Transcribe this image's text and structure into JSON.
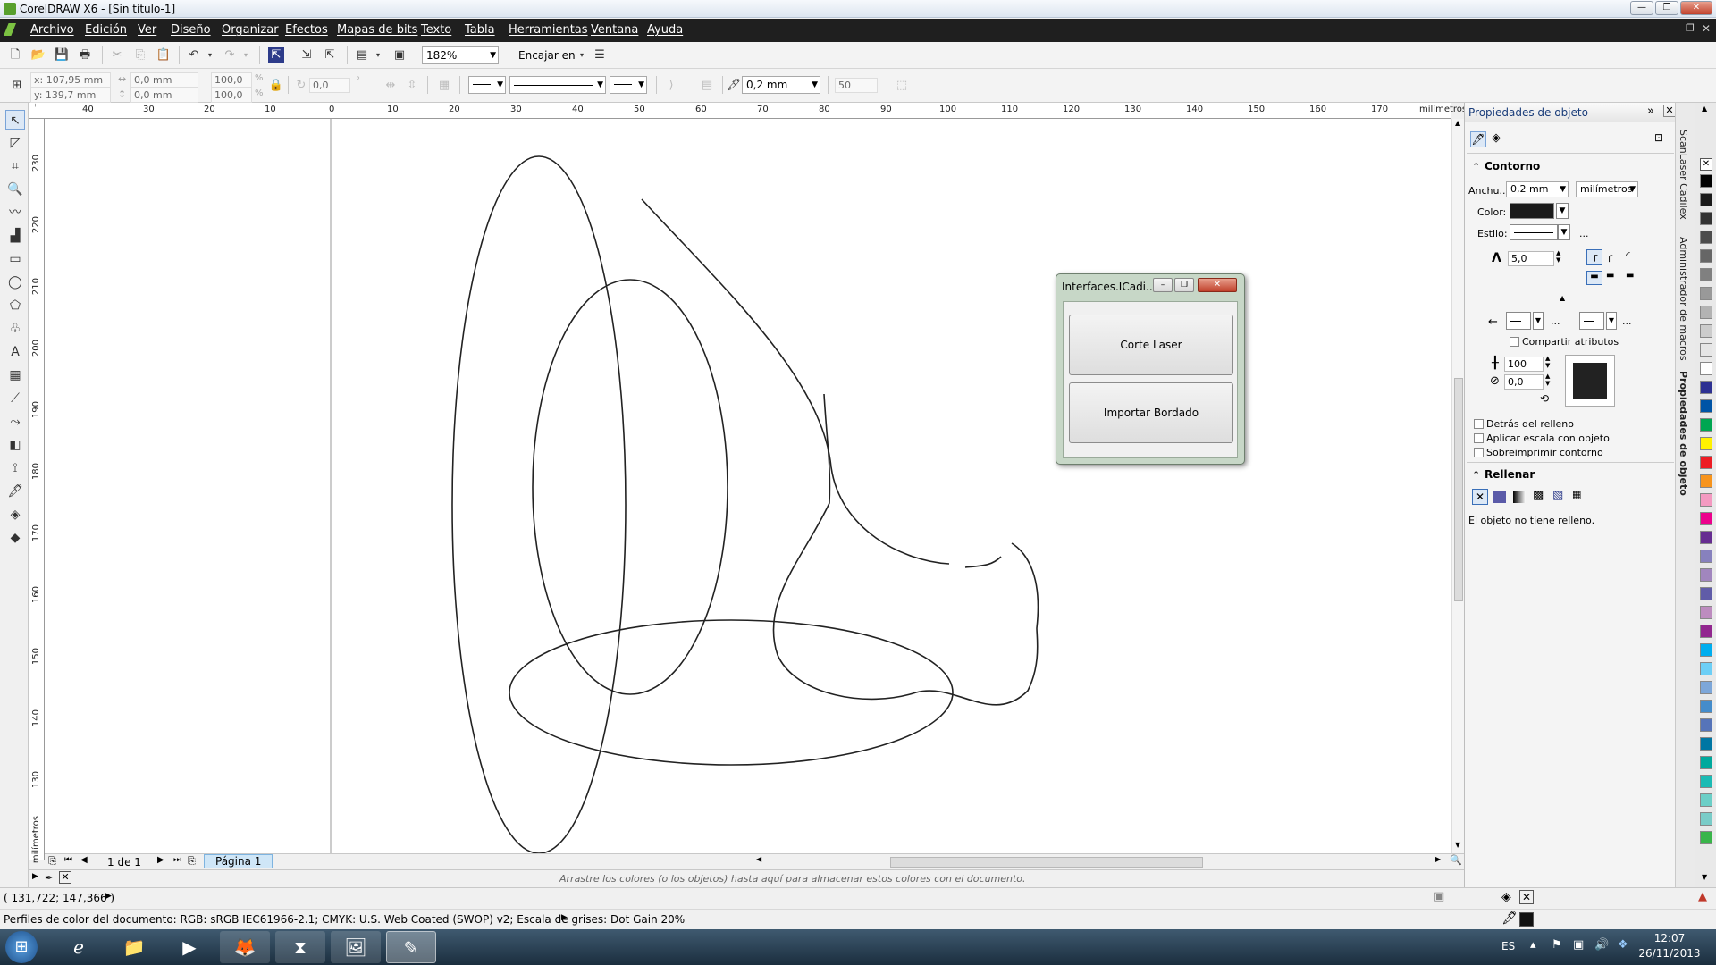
{
  "window": {
    "title": "CorelDRAW X6 - [Sin título-1]"
  },
  "menu": [
    "Archivo",
    "Edición",
    "Ver",
    "Diseño",
    "Organizar",
    "Efectos",
    "Mapas de bits",
    "Texto",
    "Tabla",
    "Herramientas",
    "Ventana",
    "Ayuda"
  ],
  "toolbar": {
    "zoom": "182%",
    "snap": "Encajar en"
  },
  "property_bar": {
    "x": "x: 107,95 mm",
    "y": "y: 139,7 mm",
    "w": "0,0 mm",
    "h": "0,0 mm",
    "scale_w": "100,0",
    "scale_h": "100,0",
    "pct": "%",
    "angle": "0,0",
    "outline_width": "0,2 mm",
    "miter": "50"
  },
  "ruler": {
    "top_labels": [
      "40",
      "30",
      "20",
      "10",
      "0",
      "10",
      "20",
      "30",
      "40",
      "50",
      "60",
      "70",
      "80",
      "90",
      "100",
      "110",
      "120",
      "130",
      "140",
      "150",
      "160",
      "170"
    ],
    "units": "milímetros",
    "left_labels": [
      "230",
      "220",
      "210",
      "200",
      "190",
      "180",
      "170",
      "160",
      "150",
      "140",
      "130"
    ],
    "left_units": "milímetros"
  },
  "page_nav": {
    "count": "1 de 1",
    "tab": "Página 1"
  },
  "color_hint": "Arrastre los colores (o los objetos) hasta aquí para almacenar estos colores con el documento.",
  "status": {
    "coords": "( 131,722; 147,366 )",
    "profile": "Perfiles de color del documento: RGB: sRGB IEC61966-2.1; CMYK: U.S. Web Coated (SWOP) v2; Escala de grises: Dot Gain 20%"
  },
  "docker": {
    "title": "Propiedades de objeto",
    "contorno": "Contorno",
    "ancho_label": "Anchu...",
    "ancho_value": "0,2 mm",
    "units": "milímetros",
    "color_label": "Color:",
    "estilo_label": "Estilo:",
    "miter": "5,0",
    "ellipsis": "...",
    "compartir": "Compartir atributos",
    "stretch": "100",
    "angle": "0,0",
    "detras": "Detrás del relleno",
    "escala": "Aplicar escala con objeto",
    "sobreimprimir": "Sobreimprimir contorno",
    "rellenar": "Rellenar",
    "sin_relleno": "El objeto no tiene relleno."
  },
  "side_tabs": [
    "ScanLaser Cadilex",
    "Administrador de macros",
    "Propiedades de objeto"
  ],
  "dialog": {
    "title": "Interfaces.ICadi...",
    "btn1": "Corte Laser",
    "btn2": "Importar Bordado"
  },
  "tray": {
    "lang": "ES",
    "time": "12:07",
    "date": "26/11/2013"
  },
  "colors": {
    "accent": "#7cc242",
    "menubar": "#1f1f1f"
  },
  "palette": [
    "#000000",
    "#1a1a1a",
    "#333333",
    "#4d4d4d",
    "#666666",
    "#808080",
    "#999999",
    "#b3b3b3",
    "#cccccc",
    "#e6e6e6",
    "#ffffff",
    "#2e3192",
    "#0054a6",
    "#00a651",
    "#fff200",
    "#ed1c24",
    "#f7941d",
    "#f49ac1",
    "#ec008c",
    "#662d91",
    "#8781bd",
    "#a186be",
    "#605ca8",
    "#bd8cbf",
    "#92278f",
    "#00aeef",
    "#6dcff6",
    "#7da7d9",
    "#448ccb",
    "#5674b9",
    "#0076a3",
    "#00a99d",
    "#1cbbb4",
    "#6ccfc7",
    "#7accc8",
    "#39b54a"
  ]
}
